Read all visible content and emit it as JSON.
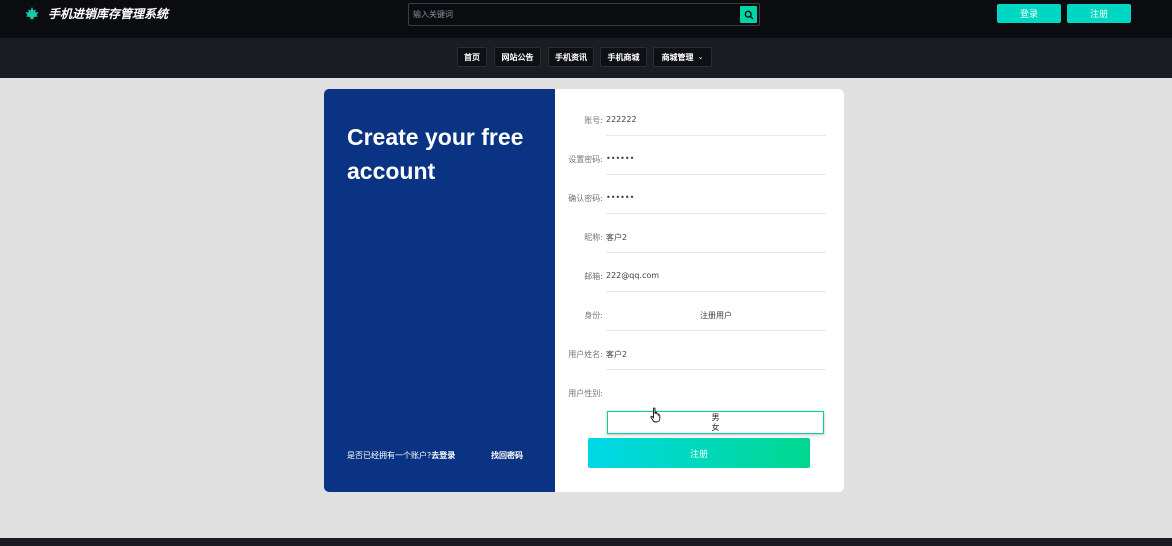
{
  "header": {
    "title": "手机进销库存管理系统",
    "logo_icon": "maple-leaf-icon",
    "search_placeholder": "输入关键词",
    "search_icon": "search-icon",
    "login_label": "登录",
    "register_label": "注册",
    "accent_color": "#00d7c3"
  },
  "nav": {
    "items": [
      {
        "label": "首页"
      },
      {
        "label": "网站公告"
      },
      {
        "label": "手机资讯"
      },
      {
        "label": "手机商城"
      },
      {
        "label": "商城管理"
      }
    ]
  },
  "panel": {
    "headline": "Create your free account",
    "have_account_text": "是否已经拥有一个账户?",
    "go_login_text": "去登录",
    "find_password_text": "找回密码",
    "panel_color": "#0a3383"
  },
  "form": {
    "account_label": "账号:",
    "account_value": "222222",
    "password_label": "设置密码:",
    "password_value": "••••••",
    "confirm_label": "确认密码:",
    "confirm_value": "••••••",
    "nickname_label": "昵称:",
    "nickname_value": "客户2",
    "email_label": "邮箱:",
    "email_value": "222@qq.com",
    "identity_label": "身份:",
    "identity_value": "注册用户",
    "username_label": "用户姓名:",
    "username_value": "客户2",
    "gender_label": "用户性别:",
    "gender_options": [
      "男",
      "女"
    ],
    "submit_label": "注册"
  }
}
